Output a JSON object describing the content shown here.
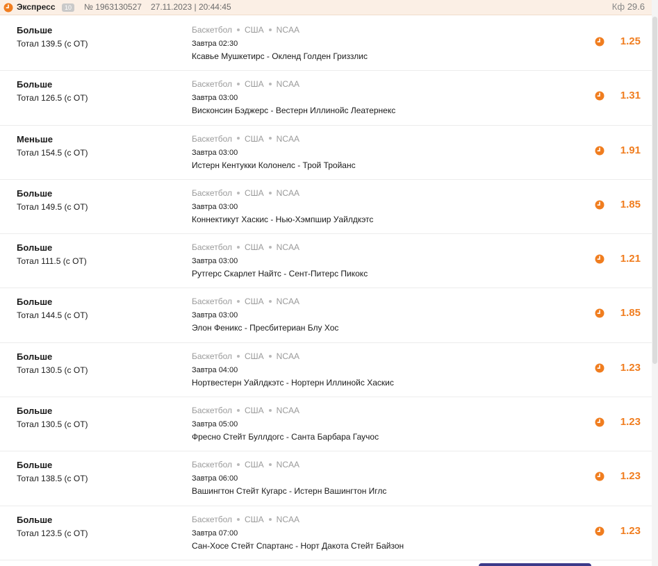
{
  "header": {
    "icon": "clock-icon",
    "title": "Экспресс",
    "count": "10",
    "number": "№ 1963130527",
    "datetime": "27.11.2023 | 20:44:45",
    "coef_label": "Кф",
    "coef_value": "29.6"
  },
  "colors": {
    "accent": "#f07d1f",
    "header_bg": "#fbefe5"
  },
  "bets": [
    {
      "pick": "Больше",
      "market": "Тотал 139.5 (с ОТ)",
      "sport": "Баскетбол",
      "country": "США",
      "league": "NCAA",
      "time": "Завтра 02:30",
      "match": "Ксавье Мушкетирс - Окленд Голден Гриззлис",
      "odds": "1.25",
      "status_icon": "pending-clock-icon"
    },
    {
      "pick": "Больше",
      "market": "Тотал 126.5 (с ОТ)",
      "sport": "Баскетбол",
      "country": "США",
      "league": "NCAA",
      "time": "Завтра 03:00",
      "match": "Висконсин Бэджерс - Вестерн Иллинойс Леатернекс",
      "odds": "1.31",
      "status_icon": "pending-clock-icon"
    },
    {
      "pick": "Меньше",
      "market": "Тотал 154.5 (с ОТ)",
      "sport": "Баскетбол",
      "country": "США",
      "league": "NCAA",
      "time": "Завтра 03:00",
      "match": "Истерн Кентукки Колонелс - Трой Тройанс",
      "odds": "1.91",
      "status_icon": "pending-clock-icon"
    },
    {
      "pick": "Больше",
      "market": "Тотал 149.5 (с ОТ)",
      "sport": "Баскетбол",
      "country": "США",
      "league": "NCAA",
      "time": "Завтра 03:00",
      "match": "Коннектикут Хаскис - Нью-Хэмпшир Уайлдкэтс",
      "odds": "1.85",
      "status_icon": "pending-clock-icon"
    },
    {
      "pick": "Больше",
      "market": "Тотал 111.5 (с ОТ)",
      "sport": "Баскетбол",
      "country": "США",
      "league": "NCAA",
      "time": "Завтра 03:00",
      "match": "Рутгерс Скарлет Найтс - Сент-Питерс Пикокс",
      "odds": "1.21",
      "status_icon": "pending-clock-icon"
    },
    {
      "pick": "Больше",
      "market": "Тотал 144.5 (с ОТ)",
      "sport": "Баскетбол",
      "country": "США",
      "league": "NCAA",
      "time": "Завтра 03:00",
      "match": "Элон Феникс - Пресбитериан Блу Хос",
      "odds": "1.85",
      "status_icon": "pending-clock-icon"
    },
    {
      "pick": "Больше",
      "market": "Тотал 130.5 (с ОТ)",
      "sport": "Баскетбол",
      "country": "США",
      "league": "NCAA",
      "time": "Завтра 04:00",
      "match": "Нортвестерн Уайлдкэтс - Нортерн Иллинойс Хаскис",
      "odds": "1.23",
      "status_icon": "pending-clock-icon"
    },
    {
      "pick": "Больше",
      "market": "Тотал 130.5 (с ОТ)",
      "sport": "Баскетбол",
      "country": "США",
      "league": "NCAA",
      "time": "Завтра 05:00",
      "match": "Фресно Стейт Буллдогс - Санта Барбара Гаучос",
      "odds": "1.23",
      "status_icon": "pending-clock-icon"
    },
    {
      "pick": "Больше",
      "market": "Тотал 138.5 (с ОТ)",
      "sport": "Баскетбол",
      "country": "США",
      "league": "NCAA",
      "time": "Завтра 06:00",
      "match": "Вашингтон Стейт Кугарс - Истерн Вашингтон Иглс",
      "odds": "1.23",
      "status_icon": "pending-clock-icon"
    },
    {
      "pick": "Больше",
      "market": "Тотал 123.5 (с ОТ)",
      "sport": "Баскетбол",
      "country": "США",
      "league": "NCAA",
      "time": "Завтра 07:00",
      "match": "Сан-Хосе Стейт Спартанс - Норт Дакота Стейт Байзон",
      "odds": "1.23",
      "status_icon": "pending-clock-icon"
    }
  ]
}
